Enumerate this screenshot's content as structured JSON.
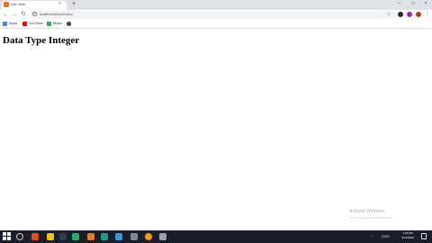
{
  "browser": {
    "tab_title": "Dev Solo",
    "tab_close": "×",
    "new_tab": "+",
    "url": "localhost/php/int.php",
    "window_controls": {
      "minimize": "–",
      "maximize": "□",
      "close": "×"
    },
    "nav": {
      "back": "←",
      "forward": "→",
      "reload": "↻",
      "info": "i",
      "star": "☆"
    }
  },
  "bookmarks": [
    {
      "label": "Apps",
      "icon": "apps-icon",
      "color": "#4285f4"
    },
    {
      "label": "YouTube",
      "icon": "youtube-icon",
      "color": "#ff0000"
    },
    {
      "label": "Maps",
      "icon": "maps-icon",
      "color": "#34a853"
    }
  ],
  "page": {
    "heading": "Data Type Integer"
  },
  "watermark": {
    "line1": "Activate Windows",
    "line2": "Go to Settings to activate Windows."
  },
  "taskbar": {
    "tray": {
      "arrow": "^",
      "lang": "ENG"
    },
    "clock": {
      "time": "1:54 PM",
      "date": "9/13/2020"
    }
  },
  "colors": {
    "accent": "#e8712b",
    "taskbar": "#1b1e2a"
  }
}
